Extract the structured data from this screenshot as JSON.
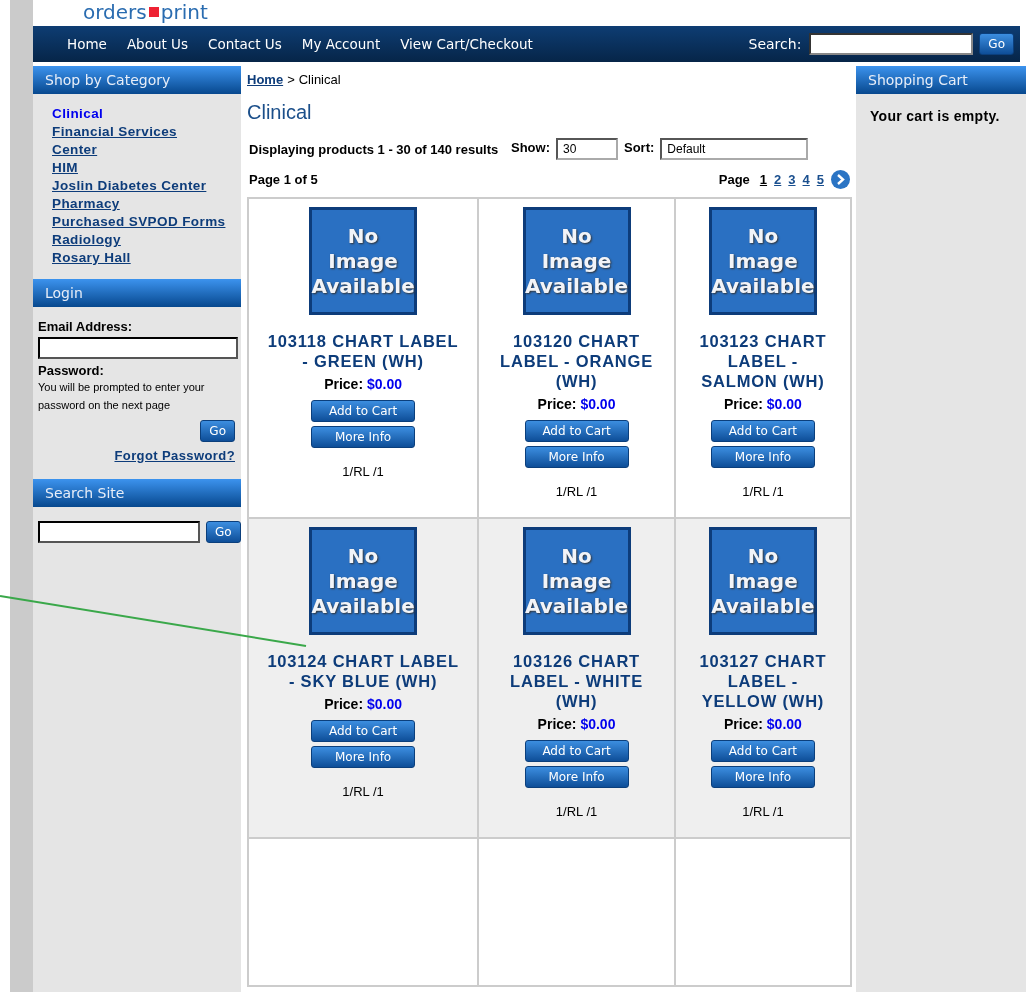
{
  "logo": {
    "left": "orders",
    "right": "print"
  },
  "nav": {
    "items": [
      "Home",
      "About Us",
      "Contact Us",
      "My Account",
      "View Cart/Checkout"
    ],
    "search_label": "Search:",
    "search_button": "Go"
  },
  "sidebar": {
    "category_title": "Shop by Category",
    "categories": [
      {
        "label": "Clinical",
        "selected": true
      },
      {
        "label": "Financial Services",
        "selected": false
      },
      {
        "label": "Center",
        "selected": false
      },
      {
        "label": "HIM",
        "selected": false
      },
      {
        "label": "Joslin Diabetes Center",
        "selected": false
      },
      {
        "label": "Pharmacy",
        "selected": false
      },
      {
        "label": "Purchased SVPOD Forms",
        "selected": false
      },
      {
        "label": "Radiology",
        "selected": false
      },
      {
        "label": "Rosary Hall",
        "selected": false
      }
    ],
    "login": {
      "title": "Login",
      "email_label": "Email Address:",
      "password_label": "Password:",
      "note": "You will be prompted to enter your password on the next page",
      "button": "Go",
      "forgot": "Forgot Password?"
    },
    "search": {
      "title": "Search Site",
      "button": "Go"
    }
  },
  "breadcrumb": {
    "home": "Home",
    "separator": ">",
    "current": "Clinical"
  },
  "heading": "Clinical",
  "summary": "Displaying products 1 - 30 of 140 results",
  "show": {
    "label": "Show:",
    "value": "30"
  },
  "sort": {
    "label": "Sort:",
    "value": "Default"
  },
  "page_of": "Page 1 of 5",
  "pager": {
    "label": "Page",
    "pages": [
      {
        "label": "1",
        "selected": true
      },
      {
        "label": "2",
        "selected": false
      },
      {
        "label": "3",
        "selected": false
      },
      {
        "label": "4",
        "selected": false
      },
      {
        "label": "5",
        "selected": false
      }
    ]
  },
  "product_rows": [
    {
      "shaded": false,
      "products": [
        {
          "image_text": "No Image Available",
          "title": "103118 CHART LABEL - GREEN (WH)",
          "price_label": "Price:",
          "price": "$0.00",
          "add": "Add to Cart",
          "more": "More Info",
          "unit": "1/RL /1"
        },
        {
          "image_text": "No Image Available",
          "title": "103120 CHART LABEL - ORANGE (WH)",
          "price_label": "Price:",
          "price": "$0.00",
          "add": "Add to Cart",
          "more": "More Info",
          "unit": "1/RL /1"
        },
        {
          "image_text": "No Image Available",
          "title": "103123 CHART LABEL - SALMON (WH)",
          "price_label": "Price:",
          "price": "$0.00",
          "add": "Add to Cart",
          "more": "More Info",
          "unit": "1/RL /1"
        }
      ]
    },
    {
      "shaded": true,
      "products": [
        {
          "image_text": "No Image Available",
          "title": "103124 CHART LABEL - SKY BLUE (WH)",
          "price_label": "Price:",
          "price": "$0.00",
          "add": "Add to Cart",
          "more": "More Info",
          "unit": "1/RL /1"
        },
        {
          "image_text": "No Image Available",
          "title": "103126 CHART LABEL - WHITE (WH)",
          "price_label": "Price:",
          "price": "$0.00",
          "add": "Add to Cart",
          "more": "More Info",
          "unit": "1/RL /1"
        },
        {
          "image_text": "No Image Available",
          "title": "103127 CHART LABEL - YELLOW (WH)",
          "price_label": "Price:",
          "price": "$0.00",
          "add": "Add to Cart",
          "more": "More Info",
          "unit": "1/RL /1"
        }
      ]
    }
  ],
  "cart": {
    "title": "Shopping Cart",
    "message": "Your cart is empty."
  }
}
